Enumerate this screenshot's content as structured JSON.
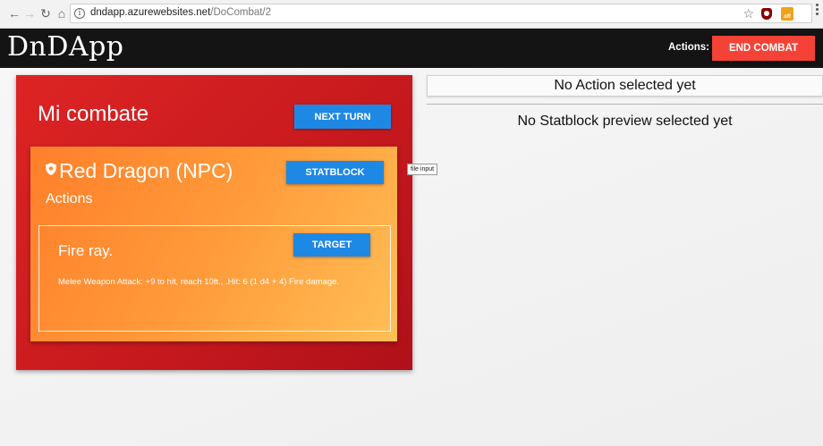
{
  "browser": {
    "url_host": "dndapp.azurewebsites.net",
    "url_path": "/DoCombat/2",
    "ext_badge": "off"
  },
  "header": {
    "brand": "DnDApp",
    "actions_label": "Actions:",
    "end_combat_label": "END COMBAT"
  },
  "combat": {
    "title": "Mi combate",
    "next_turn_label": "NEXT TURN",
    "npc": {
      "name": "Red Dragon (NPC)",
      "statblock_label": "STATBLOCK",
      "actions_heading": "Actions",
      "action": {
        "name": "Fire ray.",
        "target_label": "TARGET",
        "description": "Melee Weapon Attack: +9 to hit, reach 10ft., .Hit: 6 (1 d4 + 4) Fire damage."
      }
    }
  },
  "tooltip": "file input",
  "right_panel": {
    "no_action": "No Action selected yet",
    "no_statblock": "No Statblock preview selected yet"
  },
  "colors": {
    "header_bg": "#141414",
    "end_combat": "#f44336",
    "button_blue": "#1e88e5",
    "combat_card": "#d41e22",
    "npc_card": "#ff9a3a"
  }
}
